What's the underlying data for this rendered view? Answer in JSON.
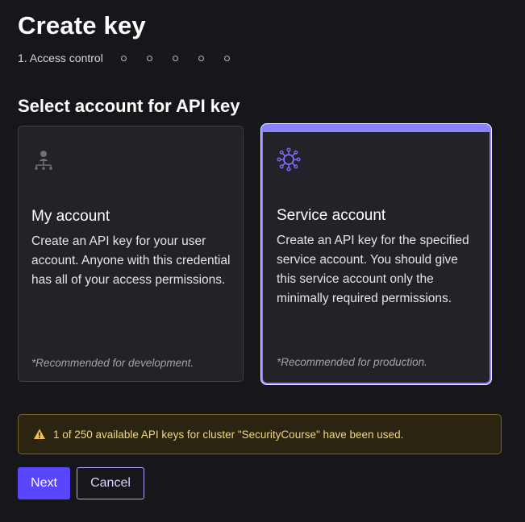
{
  "page": {
    "title": "Create key"
  },
  "stepper": {
    "current_step_label": "1. Access control",
    "remaining_steps": 5
  },
  "section": {
    "heading": "Select account for API key"
  },
  "cards": [
    {
      "id": "my-account",
      "icon": "user-network-icon",
      "title": "My account",
      "description": "Create an API key for your user account. Anyone with this credential has all of your access permissions.",
      "note": "*Recommended for development.",
      "selected": false
    },
    {
      "id": "service-account",
      "icon": "service-network-icon",
      "title": "Service account",
      "description": "Create an API key for the specified service account. You should give this service account only the minimally required permissions.",
      "note": "*Recommended for production.",
      "selected": true
    }
  ],
  "alert": {
    "icon": "warning-icon",
    "text": "1 of 250 available API keys for cluster \"SecurityCourse\" have been used."
  },
  "actions": {
    "next_label": "Next",
    "cancel_label": "Cancel"
  },
  "colors": {
    "background": "#17171b",
    "card": "#222228",
    "accent": "#8b82ff",
    "primary_button": "#5a46ff",
    "warning_bg": "#2a2410",
    "warning_border": "#7a6525",
    "warning_text": "#f2d77c"
  }
}
